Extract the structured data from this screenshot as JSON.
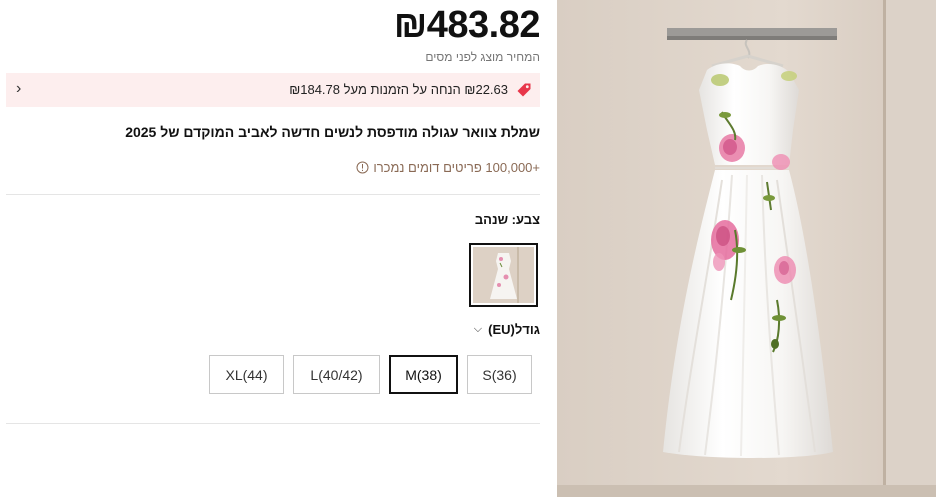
{
  "product": {
    "price": "₪483.82",
    "tax_note": "המחיר מוצג לפני מסים",
    "promo": {
      "text": "₪22.63 הנחה על הזמנות מעל ₪184.78",
      "icon": "tag-icon",
      "chevron": "chevron-left-icon",
      "accent_color": "#e8364a"
    },
    "title": "שמלת צוואר עגולה מודפסת לנשים חדשה לאביב המוקדם של 2025",
    "sold_text": "+100,000 פריטים דומים נמכרו",
    "sold_icon": "info-icon",
    "color": {
      "label": "צבע: שנהב"
    },
    "size": {
      "label": "גודל(EU)",
      "chevron": "chevron-down-icon",
      "options": [
        {
          "label": "S(36)",
          "selected": false
        },
        {
          "label": "M(38)",
          "selected": true
        },
        {
          "label": "L(40/42)",
          "selected": false
        },
        {
          "label": "XL(44)",
          "selected": false
        }
      ]
    }
  },
  "image": {
    "subject": "white floral print midi dress on hanger"
  }
}
